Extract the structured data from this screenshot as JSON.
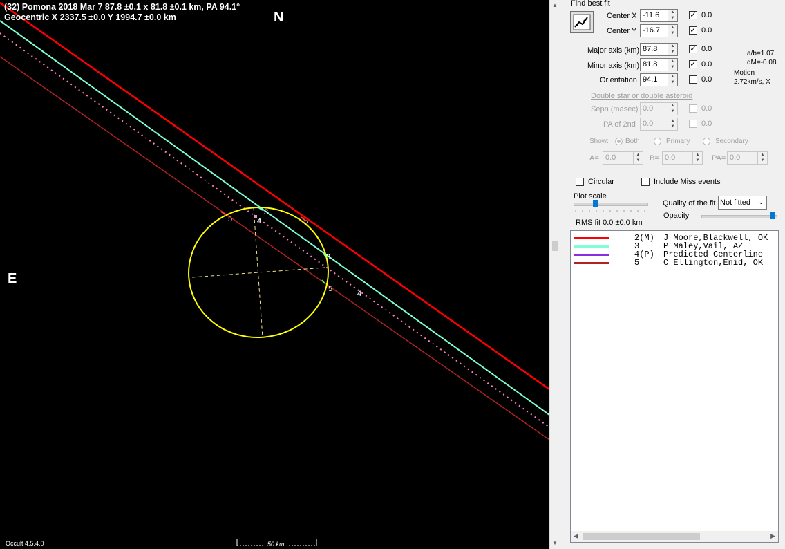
{
  "plot": {
    "header_line1": "(32) Pomona  2018 Mar 7   87.8 ±0.1 x 81.8 ±0.1 km,  PA 94.1°",
    "header_line2": "Geocentric  X  2337.5 ±0.0  Y  1994.7 ±0.0 km",
    "north": "N",
    "east": "E",
    "version": "Occult 4.5.4.0",
    "scale_bar": "50 km",
    "chord_labels": {
      "c5a": "5",
      "c4a": "4",
      "c3a": "3",
      "c2a": "2",
      "c3b": "3",
      "c5b": "5",
      "c4b": "4"
    }
  },
  "panel": {
    "find_best_fit": "Find best fit",
    "center_x": {
      "label": "Center X",
      "value": "-11.6",
      "fit_checked": true,
      "fit_value": "0.0"
    },
    "center_y": {
      "label": "Center Y",
      "value": "-16.7",
      "fit_checked": true,
      "fit_value": "0.0"
    },
    "major_axis": {
      "label": "Major axis (km)",
      "value": "87.8",
      "fit_checked": true,
      "fit_value": "0.0"
    },
    "minor_axis": {
      "label": "Minor axis (km)",
      "value": "81.8",
      "fit_checked": true,
      "fit_value": "0.0"
    },
    "orientation": {
      "label": "Orientation",
      "value": "94.1",
      "fit_checked": false,
      "fit_value": "0.0"
    },
    "ab_ratio": "a/b=1.07",
    "dm": "dM=-0.08",
    "motion_label": "Motion",
    "motion_value": "2.72km/s, X",
    "double_star_link": "Double star  or  double asteroid",
    "sepn": {
      "label": "Sepn (masec)",
      "value": "0.0",
      "fit_value": "0.0"
    },
    "pa2": {
      "label": "PA of 2nd",
      "value": "0.0",
      "fit_value": "0.0"
    },
    "show_label": "Show:",
    "show_options": [
      "Both",
      "Primary",
      "Secondary"
    ],
    "show_selected": "Both",
    "a_label": "A=",
    "a_value": "0.0",
    "b_label": "B=",
    "b_value": "0.0",
    "pa_label": "PA=",
    "pa_value": "0.0",
    "circular": "Circular",
    "include_miss": "Include Miss events",
    "plot_scale": "Plot scale",
    "quality_label": "Quality of the fit",
    "quality_value": "Not fitted",
    "opacity": "Opacity",
    "rms_fit": "RMS fit 0.0 ±0.0 km"
  },
  "legend": {
    "rows": [
      {
        "code": "2(M)",
        "observer": "J Moore,Blackwell, OK",
        "color": "#ff0000"
      },
      {
        "code": "3",
        "observer": "P Maley,Vail, AZ",
        "color": "#7fffd4"
      },
      {
        "code": "4(P)",
        "observer": "Predicted Centerline",
        "color": "#8a2be2"
      },
      {
        "code": "5",
        "observer": "C Ellington,Enid, OK",
        "color": "#b22222"
      }
    ]
  },
  "colors": {
    "chord_2": "#ff0000",
    "chord_3": "#7fffd4",
    "chord_4_dots": "#ff7fbf",
    "chord_5": "#b22222",
    "ellipse": "#ffff00",
    "slider_thumb": "#0078d7"
  }
}
